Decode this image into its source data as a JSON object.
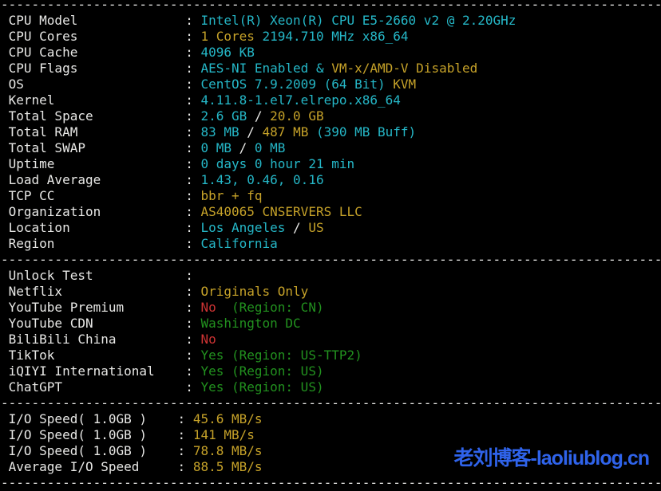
{
  "colors": {
    "bg": "#000000",
    "white": "#e8e8e6",
    "cyan": "#25b7c7",
    "yellow": "#c6a229",
    "green": "#22921f",
    "red": "#cd3333",
    "blue": "#2f63ea"
  },
  "terminal": {
    "separator": "--------------------------------------------------------------------------------------",
    "watermark": "老刘博客-laoliublog.cn",
    "sections": [
      {
        "name": "system-info",
        "label_width": 23,
        "rows": [
          {
            "label": "CPU Model",
            "parts": [
              [
                "cyan",
                "Intel(R) Xeon(R) CPU E5-2660 v2 @ 2.20GHz"
              ]
            ]
          },
          {
            "label": "CPU Cores",
            "parts": [
              [
                "yellow",
                "1 Cores"
              ],
              [
                "cyan",
                " 2194.710 MHz x86_64"
              ]
            ]
          },
          {
            "label": "CPU Cache",
            "parts": [
              [
                "cyan",
                "4096 KB"
              ]
            ]
          },
          {
            "label": "CPU Flags",
            "parts": [
              [
                "cyan",
                "AES-NI Enabled & "
              ],
              [
                "yellow",
                "VM-x/AMD-V Disabled"
              ]
            ]
          },
          {
            "label": "OS",
            "parts": [
              [
                "cyan",
                "CentOS 7.9.2009 (64 Bit) "
              ],
              [
                "yellow",
                "KVM"
              ]
            ]
          },
          {
            "label": "Kernel",
            "parts": [
              [
                "cyan",
                "4.11.8-1.el7.elrepo.x86_64"
              ]
            ]
          },
          {
            "label": "Total Space",
            "parts": [
              [
                "cyan",
                "2.6 GB"
              ],
              [
                "white",
                " / "
              ],
              [
                "yellow",
                "20.0 GB"
              ]
            ]
          },
          {
            "label": "Total RAM",
            "parts": [
              [
                "cyan",
                "83 MB"
              ],
              [
                "white",
                " / "
              ],
              [
                "yellow",
                "487 MB"
              ],
              [
                "cyan",
                " (390 MB Buff)"
              ]
            ]
          },
          {
            "label": "Total SWAP",
            "parts": [
              [
                "cyan",
                "0 MB"
              ],
              [
                "white",
                " / "
              ],
              [
                "cyan",
                "0 MB"
              ]
            ]
          },
          {
            "label": "Uptime",
            "parts": [
              [
                "cyan",
                "0 days 0 hour 21 min"
              ]
            ]
          },
          {
            "label": "Load Average",
            "parts": [
              [
                "cyan",
                "1.43, 0.46, 0.16"
              ]
            ]
          },
          {
            "label": "TCP CC",
            "parts": [
              [
                "yellow",
                "bbr + fq"
              ]
            ]
          },
          {
            "label": "Organization",
            "parts": [
              [
                "yellow",
                "AS40065 CNSERVERS LLC"
              ]
            ]
          },
          {
            "label": "Location",
            "parts": [
              [
                "cyan",
                "Los Angeles"
              ],
              [
                "white",
                " / "
              ],
              [
                "yellow",
                "US"
              ]
            ]
          },
          {
            "label": "Region",
            "parts": [
              [
                "cyan",
                "California"
              ]
            ]
          }
        ]
      },
      {
        "name": "unlock-test",
        "label_width": 23,
        "rows": [
          {
            "label": "Unlock Test",
            "parts": []
          },
          {
            "label": "Netflix",
            "parts": [
              [
                "yellow",
                "Originals Only"
              ]
            ]
          },
          {
            "label": "YouTube Premium",
            "parts": [
              [
                "red",
                "No"
              ],
              [
                "green",
                "  (Region: CN)"
              ]
            ]
          },
          {
            "label": "YouTube CDN",
            "parts": [
              [
                "green",
                "Washington DC"
              ]
            ]
          },
          {
            "label": "BiliBili China",
            "parts": [
              [
                "red",
                "No"
              ]
            ]
          },
          {
            "label": "TikTok",
            "parts": [
              [
                "green",
                "Yes (Region: US-TTP2)"
              ]
            ]
          },
          {
            "label": "iQIYI International",
            "parts": [
              [
                "green",
                "Yes (Region: US)"
              ]
            ]
          },
          {
            "label": "ChatGPT",
            "parts": [
              [
                "green",
                "Yes (Region: US)"
              ]
            ]
          }
        ]
      },
      {
        "name": "io-speed",
        "label_width": 22,
        "rows": [
          {
            "label": "I/O Speed( 1.0GB )",
            "parts": [
              [
                "yellow",
                "45.6 MB/s"
              ]
            ]
          },
          {
            "label": "I/O Speed( 1.0GB )",
            "parts": [
              [
                "yellow",
                "141 MB/s"
              ]
            ]
          },
          {
            "label": "I/O Speed( 1.0GB )",
            "parts": [
              [
                "yellow",
                "78.8 MB/s"
              ]
            ]
          },
          {
            "label": "Average I/O Speed",
            "parts": [
              [
                "yellow",
                "88.5 MB/s"
              ]
            ]
          }
        ]
      }
    ]
  }
}
